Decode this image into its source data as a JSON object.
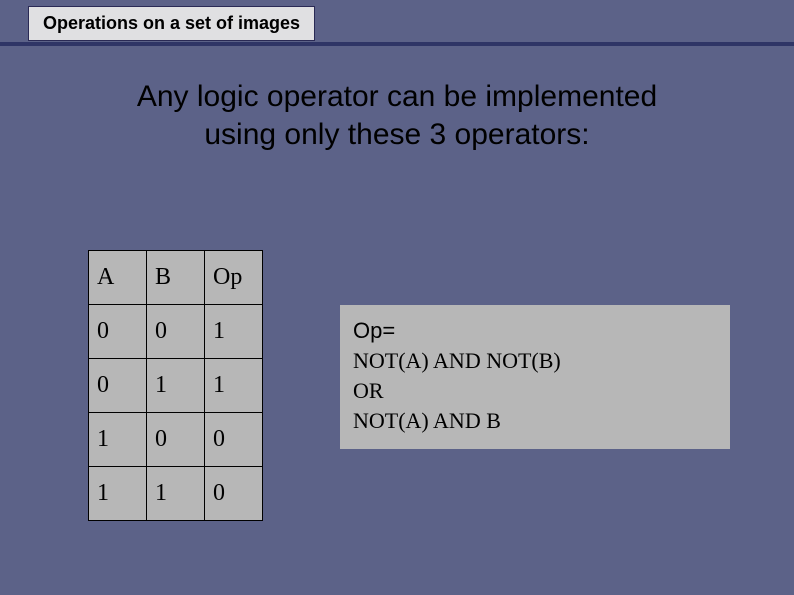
{
  "slide": {
    "title": "Operations on a set of images",
    "headline_line1": "Any logic operator can be implemented",
    "headline_line2": "using only these 3 operators:"
  },
  "chart_data": {
    "type": "table",
    "columns": [
      "A",
      "B",
      "Op"
    ],
    "rows": [
      [
        "0",
        "0",
        "1"
      ],
      [
        "0",
        "1",
        "1"
      ],
      [
        "1",
        "0",
        "0"
      ],
      [
        "1",
        "1",
        "0"
      ]
    ]
  },
  "explain": {
    "label": "Op=",
    "line1": "NOT(A) AND NOT(B)",
    "line2": "OR",
    "line3": "NOT(A) AND B"
  }
}
